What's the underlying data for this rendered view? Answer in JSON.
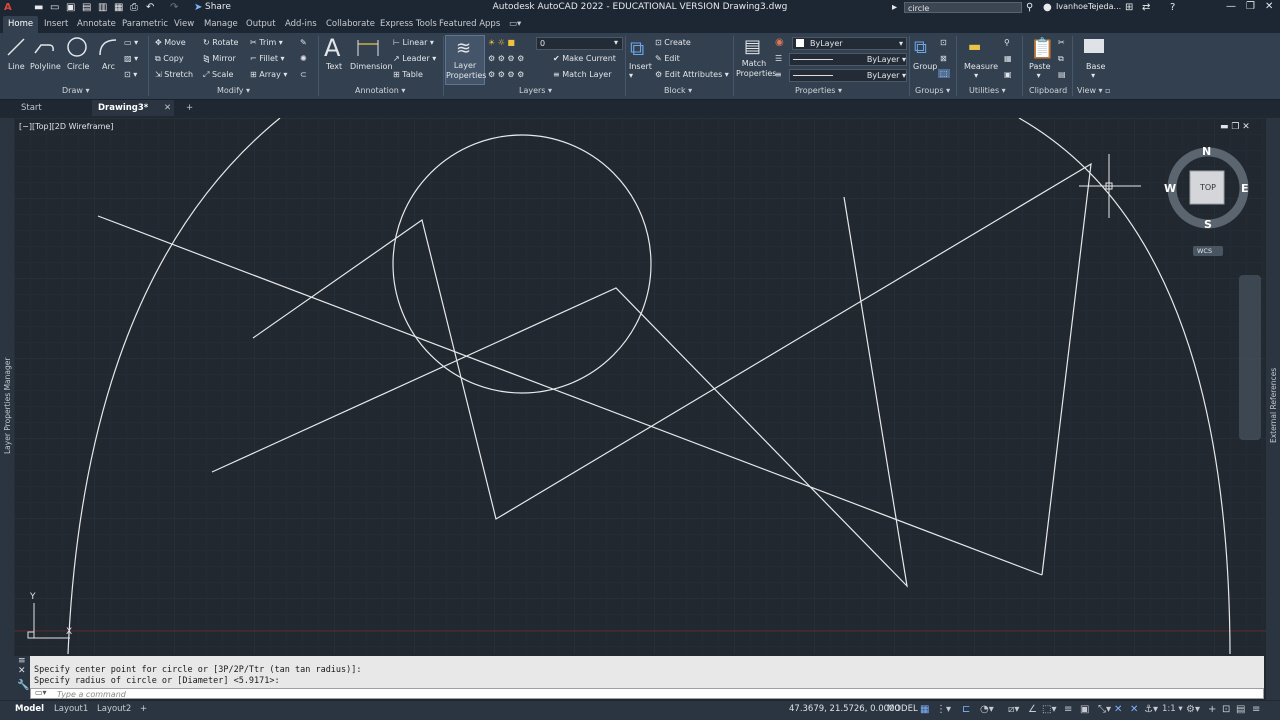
{
  "app": {
    "title": "Autodesk AutoCAD 2022 - EDUCATIONAL VERSION    Drawing3.dwg",
    "share_label": "Share",
    "search_value": "circle",
    "user_name": "IvanhoeTejeda...",
    "icons": [
      "app-menu-icon",
      "new-icon",
      "open-icon",
      "save-icon",
      "saveas-icon",
      "plot-icon",
      "undo-icon",
      "redo-icon",
      "share-icon",
      "binoculars-icon",
      "user-icon",
      "cart-icon",
      "exchange-icon",
      "help-icon",
      "minimize-icon",
      "restore-icon",
      "close-icon"
    ]
  },
  "ribbon_tabs": [
    "Home",
    "Insert",
    "Annotate",
    "Parametric",
    "View",
    "Manage",
    "Output",
    "Add-ins",
    "Collaborate",
    "Express Tools",
    "Featured Apps"
  ],
  "ribbon": {
    "draw": {
      "title": "Draw",
      "line": "Line",
      "polyline": "Polyline",
      "circle": "Circle",
      "arc": "Arc"
    },
    "modify": {
      "title": "Modify",
      "move": "Move",
      "rotate": "Rotate",
      "trim": "Trim",
      "copy": "Copy",
      "mirror": "Mirror",
      "fillet": "Fillet",
      "stretch": "Stretch",
      "scale": "Scale",
      "array": "Array"
    },
    "annotation": {
      "title": "Annotation",
      "text": "Text",
      "dimension": "Dimension",
      "linear": "Linear",
      "leader": "Leader",
      "table": "Table"
    },
    "layers": {
      "title": "Layers",
      "layer_properties": "Layer Properties",
      "layer_value": "0",
      "make_current": "Make Current",
      "match_layer": "Match Layer"
    },
    "block": {
      "title": "Block",
      "insert": "Insert",
      "create": "Create",
      "edit": "Edit",
      "edit_attributes": "Edit Attributes"
    },
    "properties": {
      "title": "Properties",
      "match_properties": "Match Properties",
      "color_value": "ByLayer",
      "linetype_value": "ByLayer",
      "lineweight_value": "ByLayer"
    },
    "groups": {
      "title": "Groups",
      "group": "Group"
    },
    "utilities": {
      "title": "Utilities",
      "measure": "Measure"
    },
    "clipboard": {
      "title": "Clipboard",
      "paste": "Paste"
    },
    "view": {
      "title": "View",
      "base": "Base"
    }
  },
  "file_tabs": {
    "start": "Start",
    "drawing": "Drawing3*"
  },
  "viewport": {
    "label": "[−][Top][2D Wireframe]",
    "viewcube": {
      "top": "TOP",
      "n": "N",
      "s": "S",
      "e": "E",
      "w": "W",
      "wcs": "WCS"
    },
    "left_palette": "Layer Properties Manager",
    "right_palette": "External References",
    "ucs_y": "Y",
    "ucs_x": "X"
  },
  "command": {
    "line1": "Specify center point for circle or [3P/2P/Ttr (tan tan radius)]:",
    "line2": "Specify radius of circle or [Diameter] <5.9171>:",
    "placeholder": "Type a command"
  },
  "status": {
    "tabs": [
      "Model",
      "Layout1",
      "Layout2"
    ],
    "coords": "47.3679, 21.5726, 0.0000",
    "space": "MODEL",
    "scale": "1:1"
  }
}
